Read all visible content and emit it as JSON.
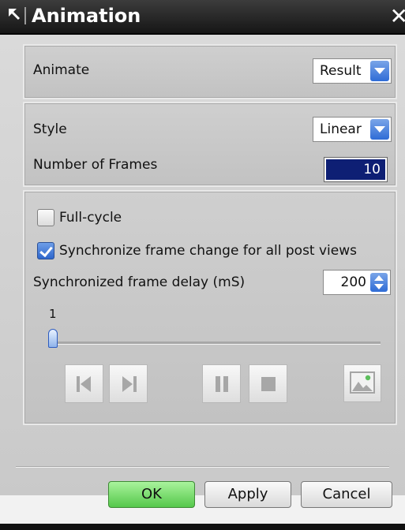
{
  "window": {
    "title": "Animation",
    "close_symbol": "✕"
  },
  "animate_group": {
    "label": "Animate",
    "select_value": "Result"
  },
  "style_group": {
    "style_label": "Style",
    "style_value": "Linear",
    "frames_label": "Number of Frames",
    "frames_value": "10"
  },
  "options_group": {
    "full_cycle_label": "Full-cycle",
    "full_cycle_checked": false,
    "sync_label": "Synchronize frame change for all post views",
    "sync_checked": true,
    "delay_label": "Synchronized frame delay (mS)",
    "delay_value": "200",
    "slider_value": "1"
  },
  "media_controls": {
    "first_icon": "first-frame-icon",
    "next_icon": "next-frame-icon",
    "play_icon": "play-icon",
    "pause_icon": "pause-icon",
    "stop_icon": "stop-icon",
    "image_icon": "image-icon"
  },
  "buttons": {
    "ok_label": "OK",
    "apply_label": "Apply",
    "cancel_label": "Cancel"
  },
  "colors": {
    "accent_blue": "#2f6cd6",
    "play_red": "#8a1111",
    "ok_green": "#55c84b",
    "frames_bg": "#0e1f74"
  }
}
